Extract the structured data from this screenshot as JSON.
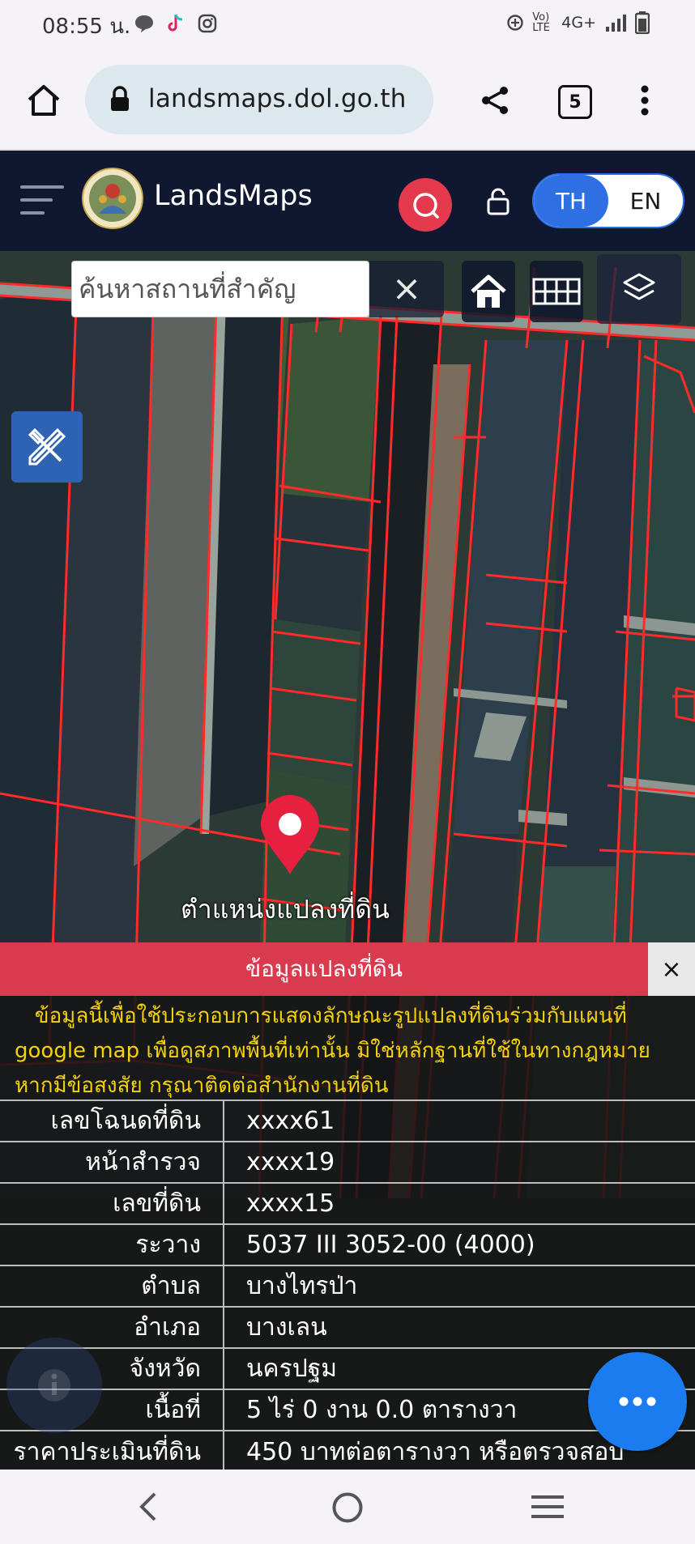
{
  "status_bar": {
    "time": "08:55 น.",
    "network": "4G+",
    "volte": "Vo) LTE"
  },
  "browser": {
    "url": "landsmaps.dol.go.th",
    "tab_count": "5"
  },
  "app": {
    "brand": "LandsMaps",
    "lang_th": "TH",
    "lang_en": "EN"
  },
  "map": {
    "search_placeholder": "ค้นหาสถานที่สำคัญ",
    "clear_symbol": "×",
    "pin_label": "ตำแหน่งแปลงที่ดิน"
  },
  "panel": {
    "title": "ข้อมูลแปลงที่ดิน",
    "close_symbol": "×",
    "notice_lines": [
      "   ข้อมูลนี้เพื่อใช้ประกอบการแสดงลักษณะรูปแปลงที่ดินร่วมกับแผนที่",
      "google map เพื่อดูสภาพพื้นที่เท่านั้น มิใช่หลักฐานที่ใช้ในทางกฎหมาย",
      "หากมีข้อสงสัย กรุณาติดต่อสำนักงานที่ดิน"
    ],
    "rows": [
      {
        "label": "เลขโฉนดที่ดิน",
        "value": "xxxx61"
      },
      {
        "label": "หน้าสำรวจ",
        "value": "xxxx19"
      },
      {
        "label": "เลขที่ดิน",
        "value": "xxxx15"
      },
      {
        "label": "ระวาง",
        "value": "5037 III 3052-00 (4000)"
      },
      {
        "label": "ตำบล",
        "value": "บางไทรป่า"
      },
      {
        "label": "อำเภอ",
        "value": "บางเลน"
      },
      {
        "label": "จังหวัด",
        "value": "นครปฐม"
      },
      {
        "label": "เนื้อที่",
        "value": "5 ไร่ 0 งาน 0.0 ตารางวา"
      },
      {
        "label": "ราคาประเมินที่ดิน",
        "value": "450 บาทต่อตารางวา หรือตรวจสอบ"
      }
    ]
  },
  "colors": {
    "header_bg": "#0f1830",
    "accent_blue": "#2f6fe4",
    "panel_red": "#d93a4d",
    "notice_yellow": "#f5d20a",
    "parcel_line": "#ff2a2a",
    "pin_red": "#e8203f",
    "fab_blue": "#1b7cf0"
  }
}
